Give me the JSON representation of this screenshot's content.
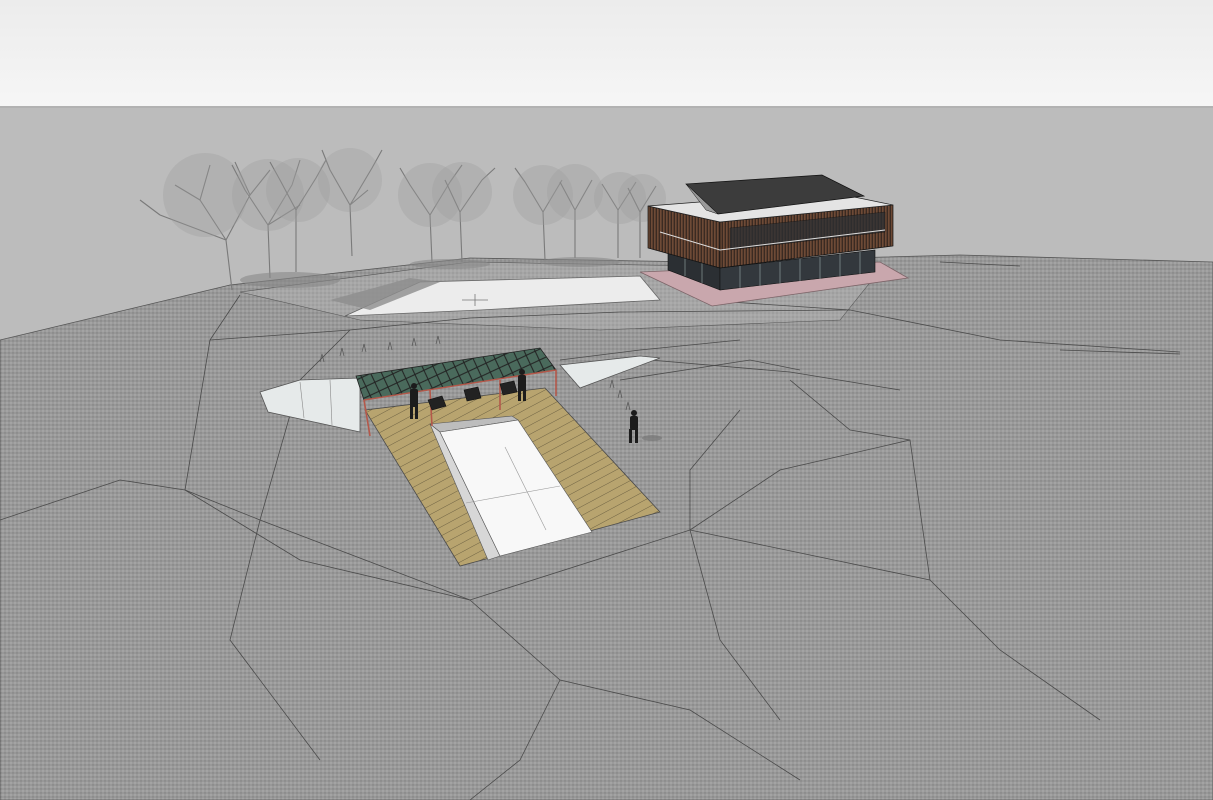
{
  "app": {
    "kind": "3d-modeling-viewport",
    "render_style": "shaded-with-edges",
    "shadows": true
  },
  "scene": {
    "sky_colors": [
      "#ececec",
      "#f6f6f6"
    ],
    "ground_colors": [
      "#9e9e9e",
      "#8b8b8b"
    ],
    "model_objects": [
      {
        "name": "house",
        "type": "building",
        "roof": "gable",
        "floors": 2,
        "facade": "wood-slat",
        "glazing": "full-height"
      },
      {
        "name": "pool",
        "type": "swimming-pool",
        "surround": "wood-deck"
      },
      {
        "name": "pergola",
        "type": "canopy",
        "cover": "glass-lattice"
      },
      {
        "name": "glass-wall",
        "type": "retaining-wall",
        "material": "glass"
      },
      {
        "name": "entrance-plaza",
        "type": "paved-area"
      },
      {
        "name": "tree-row",
        "type": "vegetation",
        "count": 8
      },
      {
        "name": "people",
        "type": "entourage",
        "count": 3
      },
      {
        "name": "lounge-chairs",
        "type": "furniture",
        "count": 3
      }
    ],
    "colors": {
      "roof": "#3c3c3c",
      "facade_wood": "#6e4a36",
      "glazing": "#2b2f33",
      "house_terrace": "#c9a7ad",
      "deck": "#b8a46f",
      "deck_line": "#6e6243",
      "pool_water": "#f8f8f8",
      "pergola_frame": "#b4584a",
      "pergola_glass": "#4a6a5c",
      "glass_wall": "#e6eaea",
      "plaza": "#ececec",
      "terrain_edge": "#4a4a4a",
      "tree": "#7a7a7a"
    }
  }
}
